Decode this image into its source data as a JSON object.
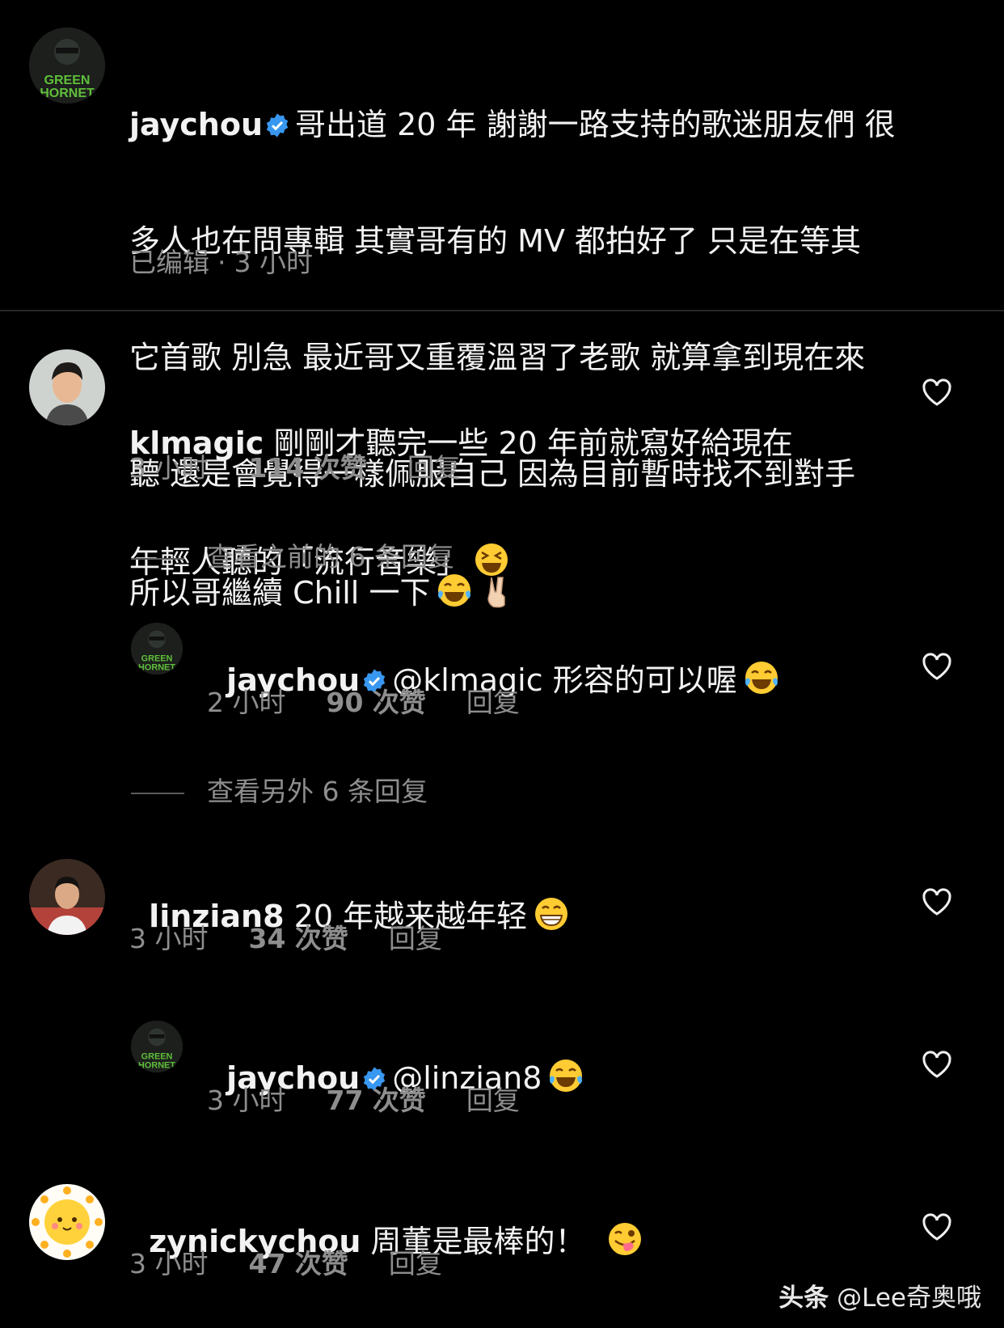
{
  "post": {
    "username": "jaychou",
    "caption_lines": [
      "哥出道 20 年 謝謝一路支持的歌迷朋友們 很",
      "多人也在問專輯 其實哥有的 MV 都拍好了 只是在等其",
      "它首歌 別急 最近哥又重覆溫習了老歌 就算拿到現在來",
      "聽 還是會覺得一樣佩服自己 因為目前暫時找不到對手",
      "所以哥繼續 Chill 一下"
    ],
    "edited_label": "已编辑",
    "time": "3 小时"
  },
  "comments": [
    {
      "username": "klmagic",
      "text_line1": "剛剛才聽完一些 20 年前就寫好給現在",
      "text_line2": "年輕人聽的「流行音樂」",
      "time": "3 小时",
      "likes": "114 次赞",
      "reply_label": "回复"
    },
    {
      "username": "jaychou",
      "text": "@klmagic 形容的可以喔",
      "time": "2 小时",
      "likes": "90 次赞",
      "reply_label": "回复"
    },
    {
      "username": "linzian8",
      "text": "20 年越来越年轻",
      "time": "3 小时",
      "likes": "34 次赞",
      "reply_label": "回复"
    },
    {
      "username": "jaychou",
      "text": "@linzian8",
      "time": "3 小时",
      "likes": "77 次赞",
      "reply_label": "回复"
    },
    {
      "username": "zynickychou",
      "text": "周董是最棒的！",
      "time": "3 小时",
      "likes": "47 次赞",
      "reply_label": "回复"
    }
  ],
  "view_previous": "查看之前的 6 条回复",
  "view_more": "查看另外 6 条回复",
  "watermark": {
    "brand": "头条",
    "handle": "@Lee奇奥哦"
  },
  "colors": {
    "background": "#000000",
    "text": "#f5f5f5",
    "secondary": "#8e8e8e",
    "verified": "#3897f0"
  },
  "icons": [
    "verified-badge-icon",
    "heart-icon",
    "tears-of-joy-emoji",
    "victory-hand-emoji",
    "grinning-squint-emoji",
    "grinning-emoji",
    "winking-tongue-emoji"
  ]
}
